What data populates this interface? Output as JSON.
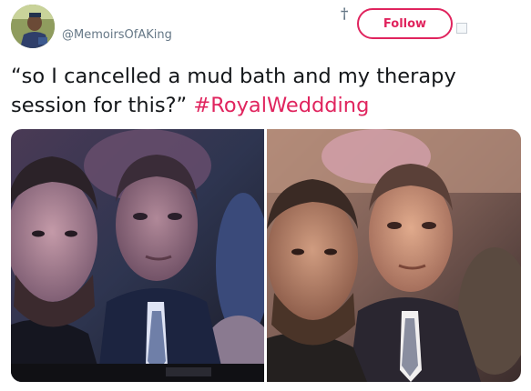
{
  "user": {
    "handle": "@MemoirsOfAKing"
  },
  "header": {
    "dagger_glyph": "†",
    "follow_label": "Follow",
    "more_icon": "caret-icon"
  },
  "tweet": {
    "text": "“so I cancelled a mud bath and my therapy session for this?” ",
    "hashtag": "#RoyalWeddding"
  },
  "media": {
    "photo_count": 2
  },
  "colors": {
    "accent": "#e0245e",
    "handle_gray": "#657786",
    "text": "#14171a"
  }
}
